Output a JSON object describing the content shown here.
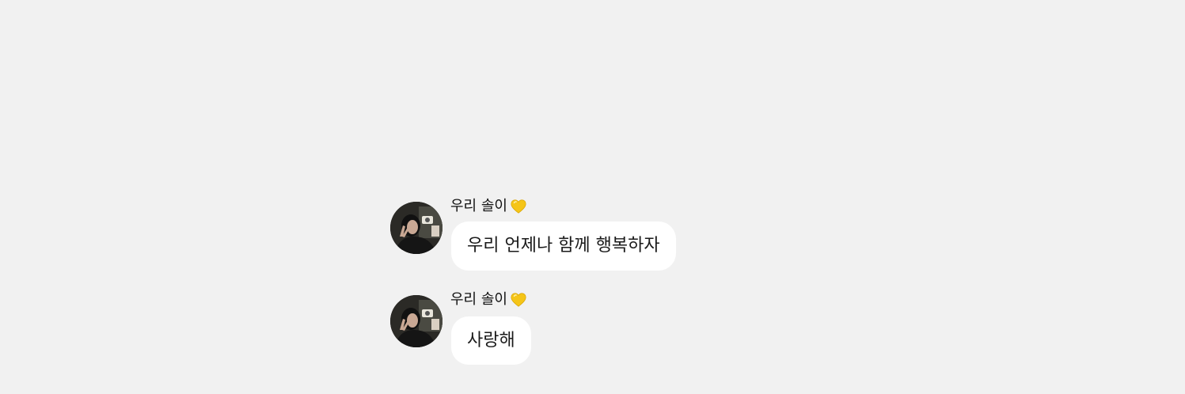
{
  "messages": [
    {
      "sender": "우리 솔이",
      "sender_emoji": "yellow-heart-icon",
      "text": "우리 언제나 함께 행복하자"
    },
    {
      "sender": "우리 솔이",
      "sender_emoji": "yellow-heart-icon",
      "text": "사랑해"
    }
  ],
  "colors": {
    "background": "#f1f1f1",
    "bubble": "#ffffff",
    "heart": "#f5c518"
  }
}
